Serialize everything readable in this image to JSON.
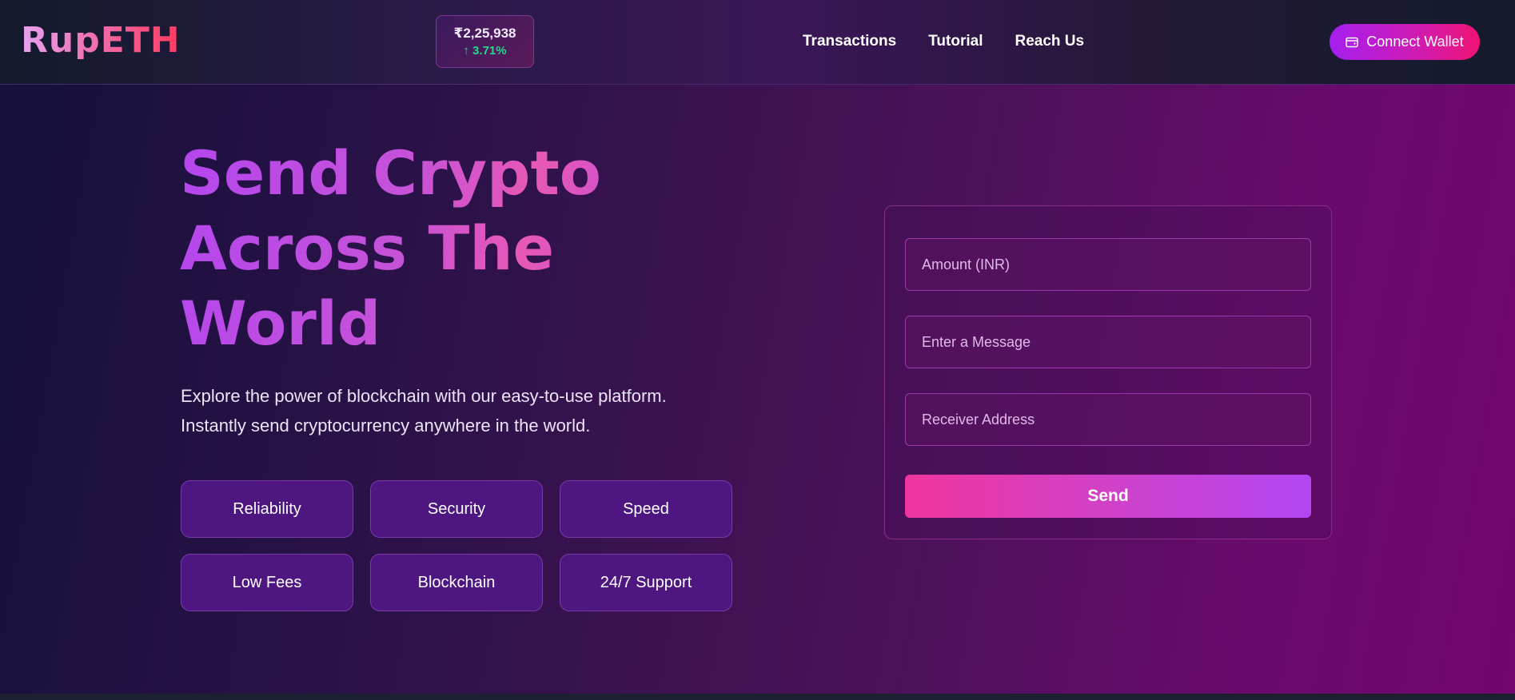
{
  "header": {
    "logo_prefix": "Rup",
    "logo_suffix": "ETH",
    "ticker": {
      "price": "₹2,25,938",
      "change": "↑ 3.71%"
    },
    "nav": [
      {
        "label": "Transactions"
      },
      {
        "label": "Tutorial"
      },
      {
        "label": "Reach Us"
      }
    ],
    "connect_wallet": {
      "label": "Connect Wallet",
      "icon": "wallet-icon"
    }
  },
  "hero": {
    "title_lines": [
      "Send Crypto",
      "Across The",
      "World"
    ],
    "subtitle_lines": [
      "Explore the power of blockchain with our easy-to-use platform.",
      "Instantly send cryptocurrency anywhere in the world."
    ],
    "features": [
      {
        "label": "Reliability"
      },
      {
        "label": "Security"
      },
      {
        "label": "Speed"
      },
      {
        "label": "Low Fees"
      },
      {
        "label": "Blockchain"
      },
      {
        "label": "24/7 Support"
      }
    ]
  },
  "form": {
    "amount_placeholder": "Amount (INR)",
    "message_placeholder": "Enter a Message",
    "address_placeholder": "Receiver Address",
    "send_label": "Send"
  },
  "colors": {
    "accent_pink": "#f0359e",
    "accent_purple": "#b246f2",
    "positive_green": "#29d68a"
  }
}
